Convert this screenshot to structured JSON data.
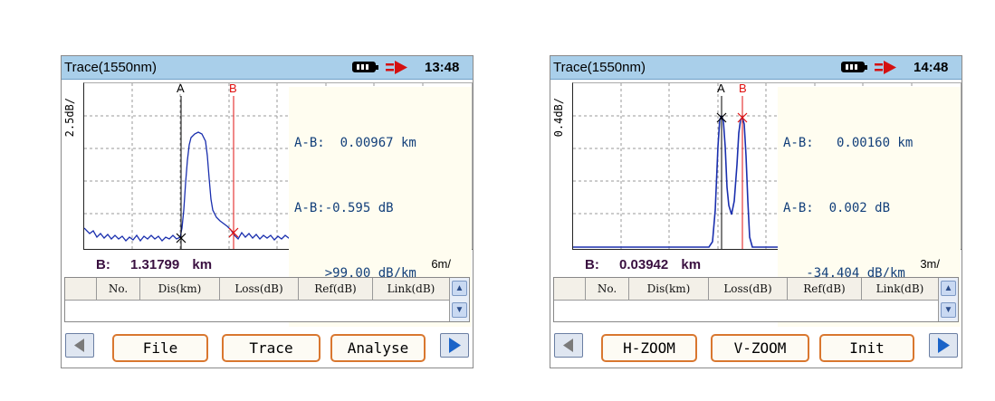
{
  "screens": [
    {
      "title": "Trace(1550nm)",
      "time": "13:48",
      "y_scale": "2.5dB/",
      "marker_a": "A",
      "marker_b": "B",
      "readout_line1": "A-B:  0.00967 km",
      "readout_line2": "A-B:-0.595 dB",
      "readout_line3": "    >99.00 dB/km",
      "b_label": "B:",
      "b_value": "1.31799",
      "b_unit": "km",
      "x_scale": "6m/",
      "columns": [
        "No.",
        "Dis(km)",
        "Loss(dB)",
        "Ref(dB)",
        "Link(dB)"
      ],
      "buttons": [
        "File",
        "Trace",
        "Analyse"
      ]
    },
    {
      "title": "Trace(1550nm)",
      "time": "14:48",
      "y_scale": "0.4dB/",
      "marker_a": "A",
      "marker_b": "B",
      "readout_line1": "A-B:   0.00160 km",
      "readout_line2": "A-B:  0.002 dB",
      "readout_line3": "   -34.404 dB/km",
      "b_label": "B:",
      "b_value": "0.03942",
      "b_unit": "km",
      "x_scale": "3m/",
      "columns": [
        "No.",
        "Dis(km)",
        "Loss(dB)",
        "Ref(dB)",
        "Link(dB)"
      ],
      "buttons": [
        "H-ZOOM",
        "V-ZOOM",
        "Init"
      ]
    }
  ],
  "colors": {
    "titlebar": "#a9cfea",
    "trace": "#1a2fae",
    "cursor_a": "#000000",
    "cursor_b": "#e01010",
    "button_border": "#d9772f",
    "clock_arrow": "#d41010"
  },
  "icons": [
    "battery-icon",
    "power-arrow-icon",
    "scroll-up-icon",
    "scroll-down-icon",
    "nav-left-icon",
    "nav-right-icon"
  ]
}
